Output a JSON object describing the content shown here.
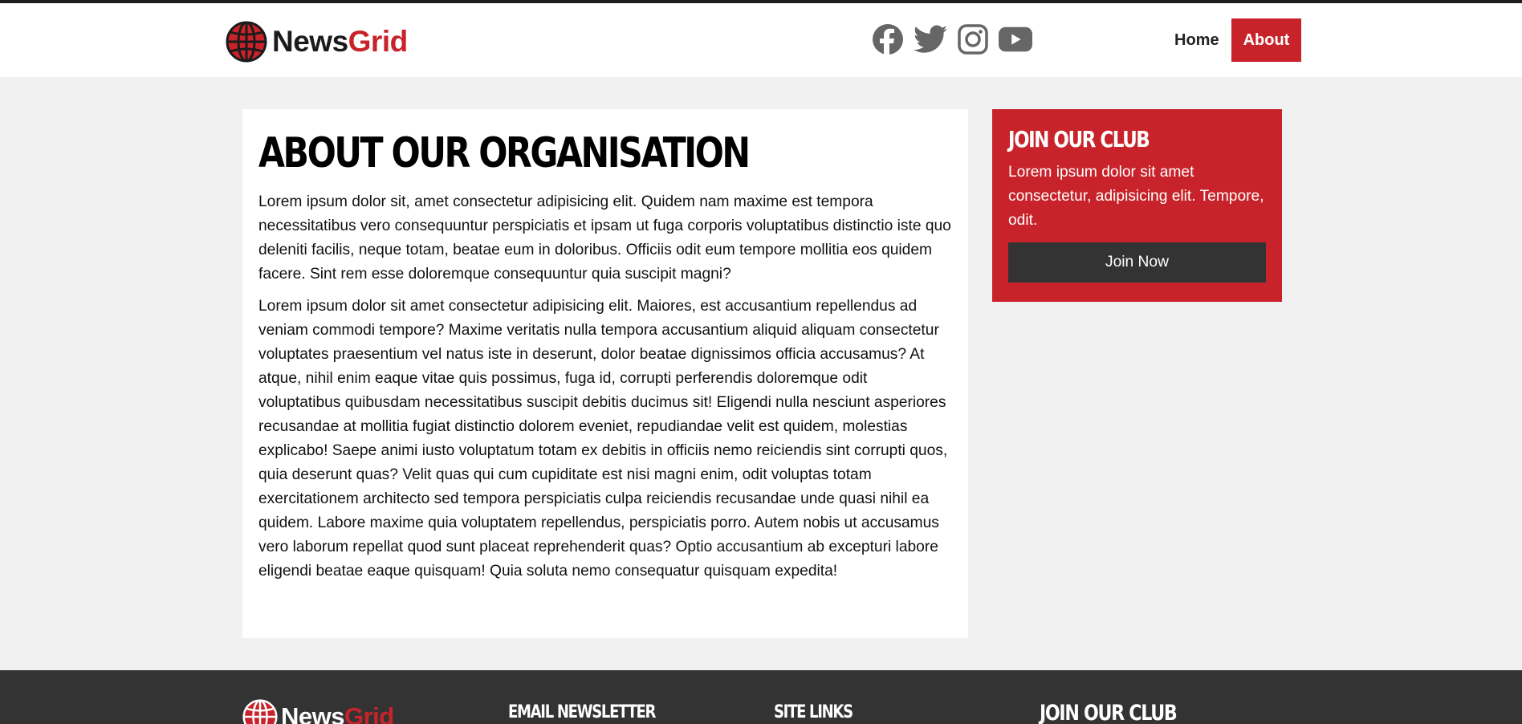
{
  "brand": {
    "name_part1": "News",
    "name_part2": "Grid",
    "primary_color": "#c8232a",
    "dark_color": "#333333"
  },
  "header": {
    "social_icons": [
      "facebook-icon",
      "twitter-icon",
      "instagram-icon",
      "youtube-icon"
    ],
    "nav": {
      "home_label": "Home",
      "about_label": "About",
      "active": "About"
    }
  },
  "main": {
    "title": "About Our Organisation",
    "paragraph1": "Lorem ipsum dolor sit, amet consectetur adipisicing elit. Quidem nam maxime est tempora necessitatibus vero consequuntur perspiciatis et ipsam ut fuga corporis voluptatibus distinctio iste quo deleniti facilis, neque totam, beatae eum in doloribus. Officiis odit eum tempore mollitia eos quidem facere. Sint rem esse doloremque consequuntur quia suscipit magni?",
    "paragraph2": "Lorem ipsum dolor sit amet consectetur adipisicing elit. Maiores, est accusantium repellendus ad veniam commodi tempore? Maxime veritatis nulla tempora accusantium aliquid aliquam consectetur voluptates praesentium vel natus iste in deserunt, dolor beatae dignissimos officia accusamus? At atque, nihil enim eaque vitae quis possimus, fuga id, corrupti perferendis doloremque odit voluptatibus quibusdam necessitatibus suscipit debitis ducimus sit! Eligendi nulla nesciunt asperiores recusandae at mollitia fugiat distinctio dolorem eveniet, repudiandae velit est quidem, molestias explicabo! Saepe animi iusto voluptatum totam ex debitis in officiis nemo reiciendis sint corrupti quos, quia deserunt quas? Velit quas qui cum cupiditate est nisi magni enim, odit voluptas totam exercitationem architecto sed tempora perspiciatis culpa reiciendis recusandae unde quasi nihil ea quidem. Labore maxime quia voluptatem repellendus, perspiciatis porro. Autem nobis ut accusamus vero laborum repellat quod sunt placeat reprehenderit quas? Optio accusantium ab excepturi labore eligendi beatae eaque quisquam! Quia soluta nemo consequatur quisquam expedita!"
  },
  "sidebar": {
    "title": "Join Our Club",
    "text": "Lorem ipsum dolor sit amet consectetur, adipisicing elit. Tempore, odit.",
    "button_label": "Join Now"
  },
  "footer": {
    "newsletter_heading": "Email Newsletter",
    "links_heading": "Site Links",
    "club_heading": "Join Our Club"
  }
}
